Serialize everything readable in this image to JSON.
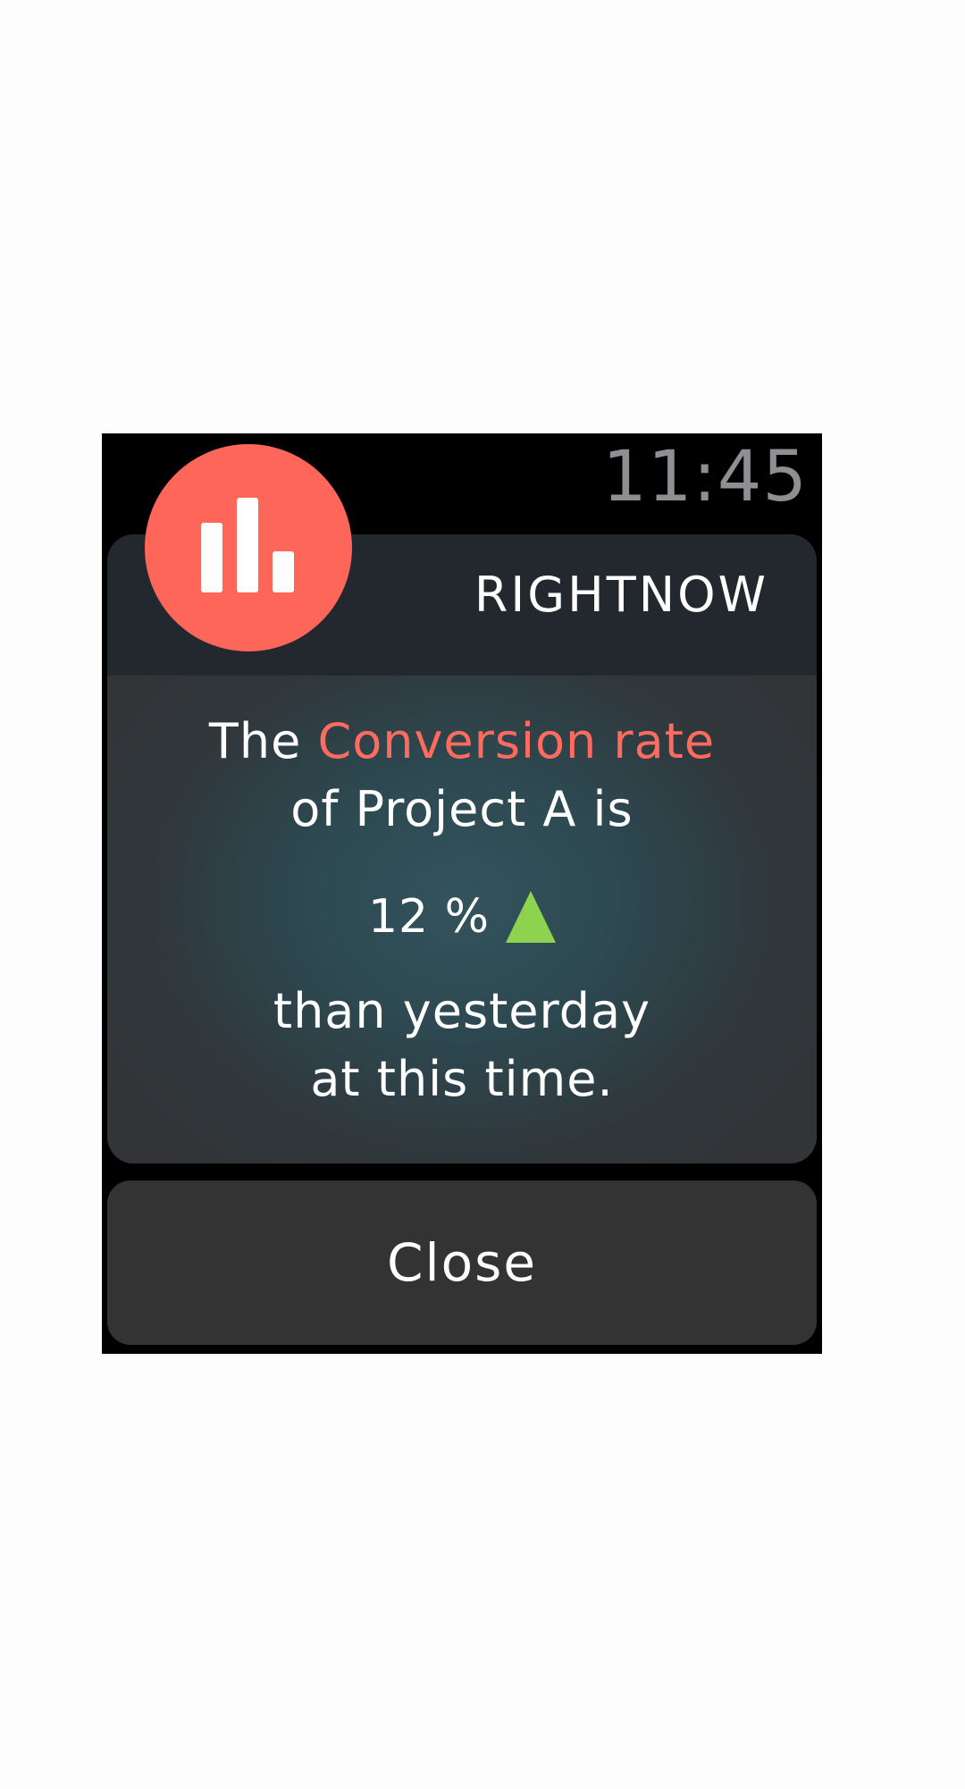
{
  "status_bar": {
    "time": "11:45"
  },
  "notification": {
    "app_icon": "bar-chart-icon",
    "app_name": "RIGHTNOW",
    "message": {
      "prefix": "The ",
      "metric": "Conversion rate",
      "line2": "of Project A is",
      "change_value": "12 %",
      "change_direction": "up",
      "change_icon": "triangle-up-icon",
      "line4": "than yesterday",
      "line5": "at this time."
    }
  },
  "actions": {
    "close_label": "Close"
  },
  "colors": {
    "accent": "#ff665a",
    "metric_text": "#ff6b5e",
    "positive": "#8ed34f",
    "time_text": "#8e8e93"
  }
}
